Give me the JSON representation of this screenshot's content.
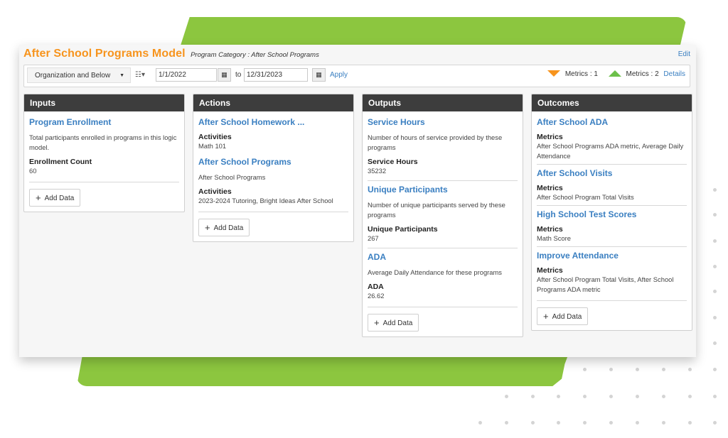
{
  "header": {
    "title": "After School Programs Model",
    "category": "Program Category : After School Programs",
    "edit_label": "Edit"
  },
  "toolbar": {
    "org_filter": "Organization and Below",
    "hierarchy_icon": "hierarchy-icon",
    "start_date": "1/1/2022",
    "to_label": "to",
    "end_date": "12/31/2023",
    "apply_label": "Apply",
    "metrics_down_label": "Metrics : 1",
    "metrics_up_label": "Metrics : 2",
    "details_label": "Details",
    "colors": {
      "down": "#f7941d",
      "up": "#6cc04a"
    }
  },
  "columns": {
    "inputs": {
      "title": "Inputs",
      "items": [
        {
          "title": "Program Enrollment",
          "description": "Total participants enrolled in programs in this logic model.",
          "field_label": "Enrollment Count",
          "field_value": "60"
        }
      ],
      "add_label": "Add Data"
    },
    "actions": {
      "title": "Actions",
      "items": [
        {
          "title": "After School Homework ...",
          "field_label": "Activities",
          "field_value": "Math 101"
        },
        {
          "title": "After School Programs",
          "description": "After School Programs",
          "field_label": "Activities",
          "field_value": "2023-2024 Tutoring, Bright Ideas After School"
        }
      ],
      "add_label": "Add Data"
    },
    "outputs": {
      "title": "Outputs",
      "items": [
        {
          "title": "Service Hours",
          "description": "Number of hours of service provided by these programs",
          "field_label": "Service Hours",
          "field_value": "35232"
        },
        {
          "title": "Unique Participants",
          "description": "Number of unique participants served by these programs",
          "field_label": "Unique Participants",
          "field_value": "267"
        },
        {
          "title": "ADA",
          "description": "Average Daily Attendance for these programs",
          "field_label": "ADA",
          "field_value": "26.62"
        }
      ],
      "add_label": "Add Data"
    },
    "outcomes": {
      "title": "Outcomes",
      "items": [
        {
          "title": "After School ADA",
          "field_label": "Metrics",
          "field_value": "After School Programs ADA metric, Average Daily Attendance"
        },
        {
          "title": "After School Visits",
          "field_label": "Metrics",
          "field_value": "After School Program Total Visits"
        },
        {
          "title": "High School Test Scores",
          "field_label": "Metrics",
          "field_value": "Math Score"
        },
        {
          "title": "Improve Attendance",
          "field_label": "Metrics",
          "field_value": "After School Program Total Visits, After School Programs ADA metric"
        }
      ],
      "add_label": "Add Data"
    }
  },
  "theme": {
    "accent": "#f7941d",
    "link": "#3a7fc1",
    "header_dark": "#3d3d3d",
    "brand_green": "#8cc63f"
  }
}
